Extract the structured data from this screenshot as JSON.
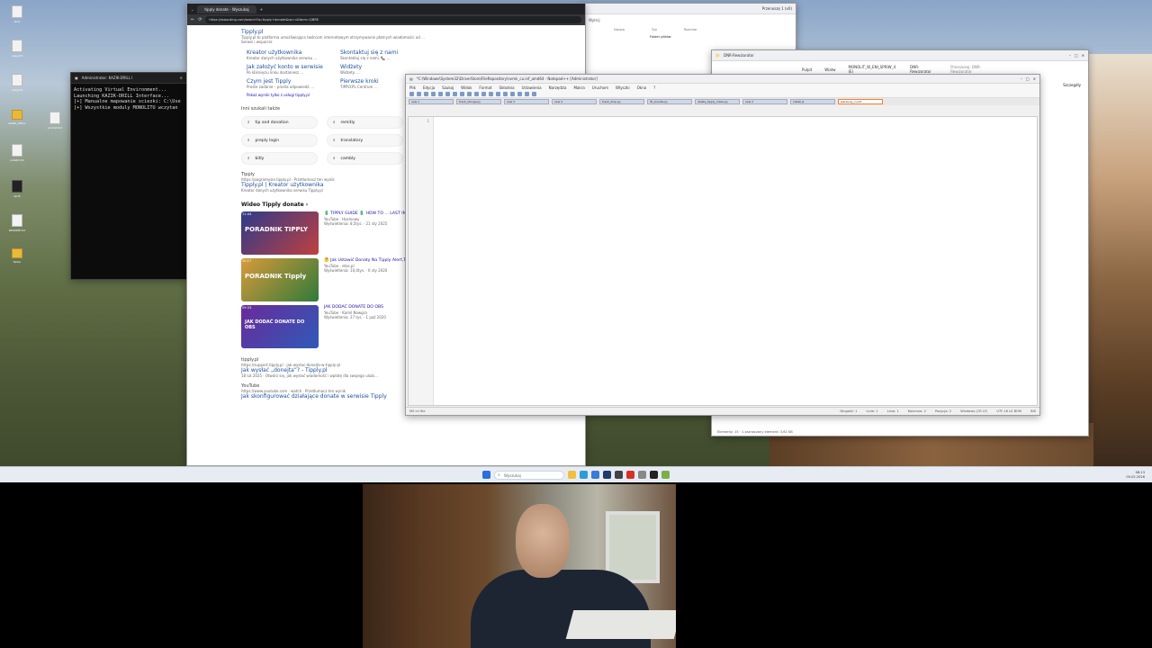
{
  "terminal": {
    "title": "Administrator: KAZIK-DRILL I",
    "lines": [
      "Activating Virtual Environment...",
      "Launching KAZIK-DRILL Interface...",
      "[+] Manualne mapowanie sciezki: C:\\Use",
      "[+] Wszystkie moduly MONOLITU wczytan"
    ]
  },
  "browser": {
    "tab_title": "tipply donate - Wyszukaj",
    "url": "https://www.bing.com/search?q=tipply+donate&qs=n&form=QBRE",
    "brand_link": "Tipply.pl",
    "brand_desc": "Tipply.pl to platforma umożliwiająca twórcom internetowym otrzymywanie płatnych wiadomości od ...",
    "brand_sub": "Serwis i wsparcie",
    "sitelinks": [
      {
        "title": "Kreator użytkownika",
        "desc": "Kreator danych użytkownika serwisu ..."
      },
      {
        "title": "Skontaktuj się z nami",
        "desc": "Skontaktuj się z nami. 📞 ..."
      },
      {
        "title": "Jak założyć konto w serwisie",
        "desc": "Po kliknięciu linku dostaniesz ..."
      },
      {
        "title": "Widżety",
        "desc": "Widżety. ..."
      },
      {
        "title": "Czym jest Tipply",
        "desc": "Proste zadanie – prosta odpowiedź. ..."
      },
      {
        "title": "Pierwsze kroki",
        "desc": "TIPPLY.PL Centrum ..."
      }
    ],
    "more_link": "Pokaż wyniki tylko z usługi tipply.pl",
    "related_title": "Inni szukali także",
    "related": [
      "tip and donation",
      "remitly",
      "preply login",
      "translatory",
      "bitly",
      "cambly"
    ],
    "result2_site": "Tipply",
    "result2_url": "https://pogramysie.tipply.pl · Przetłumacz ten wynik",
    "result2_title": "Tipply.pl | Kreator użytkownika",
    "result2_desc": "Kreator danych użytkownika serwisu Tipply.pl",
    "video_header": "Wideo Tipply donate ›",
    "videos": [
      {
        "title": "💲 TIPPLY GUIDE 💲 HOW TO ... LAST IN OBS 🔥",
        "channel": "YouTube · Hozinowy",
        "meta": "Wyświetlenia: 8,5tys. · 21 sty 2025",
        "duration": "11:44",
        "thumb_text": "PORADNIK TIPPLY"
      },
      {
        "title": "🤔 Jak Ustawić Donaty Na Tipply Alert,Top,Last,Cel,Licznik 🤔",
        "channel": "YouTube · etos.pl",
        "meta": "Wyświetlenia: 10,4tys. · 6 sty 2020",
        "duration": "10:17",
        "thumb_text": "PORADNIK Tipply"
      },
      {
        "title": "JAK DODAĆ DONATE DO OBS",
        "channel": "YouTube · Kamil Nowgra",
        "meta": "Wyświetlenia: 27 tys. · 1 paź 2020",
        "duration": "09:33",
        "thumb_text": "JAK DODAĆ DONATE DO OBS"
      }
    ],
    "result3_site": "tipply.pl",
    "result3_url": "https://support.tipply.pl · jak-wyslac-donejta-w-tipply-pl",
    "result3_title": "Jak wysłać „donejta”? - Tipply.pl",
    "result3_desc": "18 lut 2025 · Otwórz się, jak wysłać wiadomość i wpłatę dla swojego ulubi...",
    "result4_site": "YouTube",
    "result4_url": "https://www.youtube.com · watch · Przetłumacz ten wynik",
    "result4_title": "Jak skonfigurować działające donate w serwisie Tipply"
  },
  "explorer_back": {
    "title": "Przenoszę 1 (x0)",
    "toolbar": "Wytnij",
    "cols": [
      "Nazwa",
      "Typ",
      "Rozmiar"
    ],
    "row": "Folder plików"
  },
  "explorer_front": {
    "title": "DNR-Rewizorator",
    "breadcrumb": [
      "Pulpit",
      "Wiatw",
      "MONOLIT_W_ENI_SPRIW_4 (E)",
      "DNR-Rewizorator"
    ],
    "search_placeholder": "Przeszukaj: DNR-Rewizorator",
    "right_label": "Szczegóły",
    "status": "Elementy: 15 · 1 zaznaczony element: 3,61 KB"
  },
  "notepad": {
    "title": "*C:\\Windows\\System32\\DriverStore\\FileRepository\\nvmii_cu.inf_amd64 - Notepad++ [Administrator]",
    "menu": [
      "Plik",
      "Edycja",
      "Szukaj",
      "Widok",
      "Format",
      "Składnia",
      "Ustawienia",
      "Narzędzia",
      "Makra",
      "Uruchom",
      "Wtyczki",
      "Okna",
      "?"
    ],
    "tabs": [
      "new 1",
      "trash_strings.py",
      "new 3",
      "new 4",
      "trash_drop.py",
      "lfs_bundle.py",
      "delete_tipply_maze.py",
      "new 2",
      "install.js",
      "wersiouy_cu.inf"
    ],
    "line_number": "1",
    "status": [
      "MS ini file",
      "Długość: 1",
      "Linie: 1",
      "Linia: 1",
      "Kolumna: 2",
      "Pozycja: 2",
      "Windows (CR LF)",
      "UTF-16 LE BOM",
      "INS"
    ]
  },
  "taskbar": {
    "search_placeholder": "Wyszukaj",
    "time": "08:13",
    "date": "05.02.2026"
  },
  "desktop_icons": [
    "Kosz",
    "nowy.txt",
    "nowy.txt",
    "KAZIK_DRILL",
    "prompt.txt",
    "notatki.txt",
    "skrót",
    "README.txt",
    "folder"
  ]
}
